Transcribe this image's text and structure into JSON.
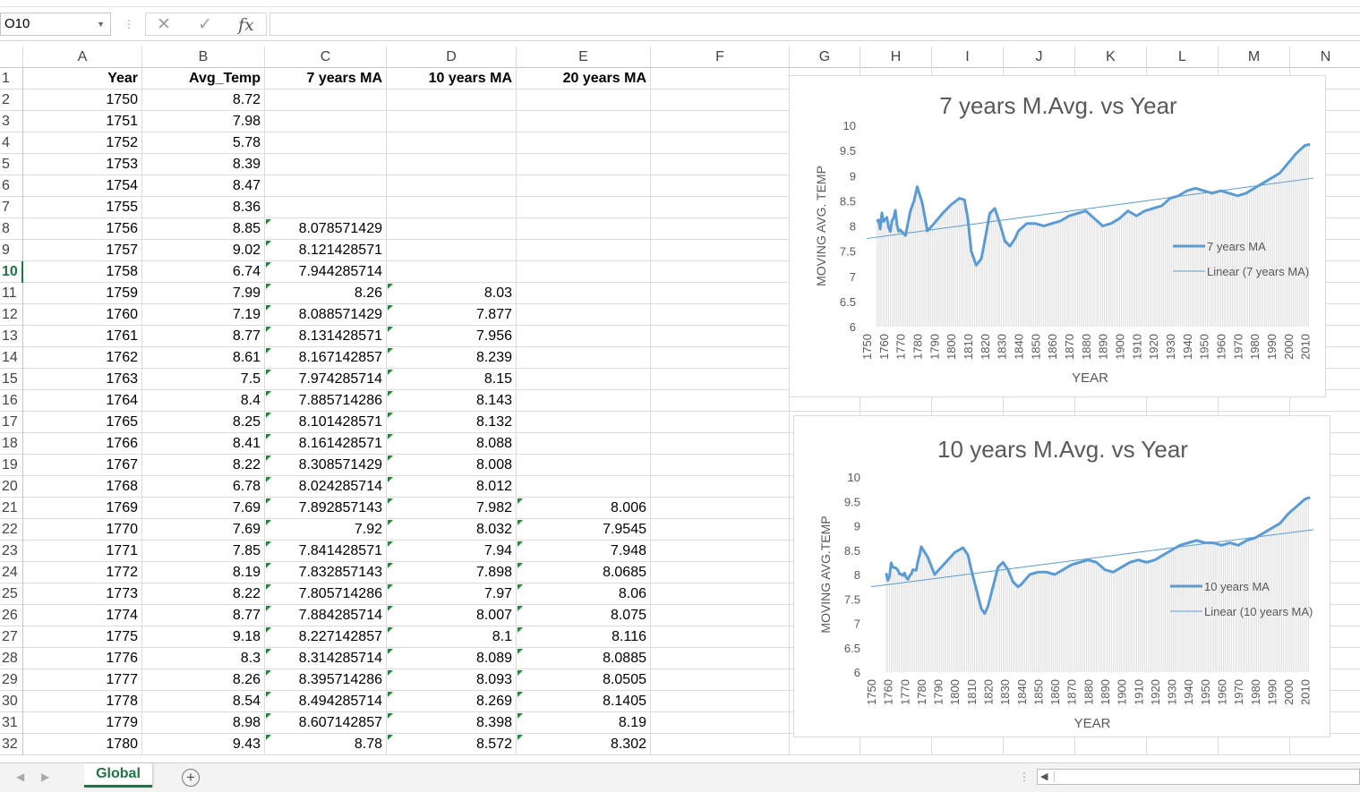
{
  "formula_bar": {
    "name_box": "O10",
    "fx_label": "fx",
    "formula": ""
  },
  "columns": [
    "A",
    "B",
    "C",
    "D",
    "E",
    "F",
    "G",
    "H",
    "I",
    "J",
    "K",
    "L",
    "M",
    "N"
  ],
  "headers": [
    "Year",
    "Avg_Temp",
    "7 years MA",
    "10 years MA",
    "20 years MA"
  ],
  "selected_row": 10,
  "rows": [
    {
      "r": 2,
      "year": "1750",
      "avg": "8.72",
      "ma7": "",
      "ma10": "",
      "ma20": ""
    },
    {
      "r": 3,
      "year": "1751",
      "avg": "7.98",
      "ma7": "",
      "ma10": "",
      "ma20": ""
    },
    {
      "r": 4,
      "year": "1752",
      "avg": "5.78",
      "ma7": "",
      "ma10": "",
      "ma20": ""
    },
    {
      "r": 5,
      "year": "1753",
      "avg": "8.39",
      "ma7": "",
      "ma10": "",
      "ma20": ""
    },
    {
      "r": 6,
      "year": "1754",
      "avg": "8.47",
      "ma7": "",
      "ma10": "",
      "ma20": ""
    },
    {
      "r": 7,
      "year": "1755",
      "avg": "8.36",
      "ma7": "",
      "ma10": "",
      "ma20": ""
    },
    {
      "r": 8,
      "year": "1756",
      "avg": "8.85",
      "ma7": "8.078571429",
      "ma10": "",
      "ma20": ""
    },
    {
      "r": 9,
      "year": "1757",
      "avg": "9.02",
      "ma7": "8.121428571",
      "ma10": "",
      "ma20": ""
    },
    {
      "r": 10,
      "year": "1758",
      "avg": "6.74",
      "ma7": "7.944285714",
      "ma10": "",
      "ma20": ""
    },
    {
      "r": 11,
      "year": "1759",
      "avg": "7.99",
      "ma7": "8.26",
      "ma10": "8.03",
      "ma20": ""
    },
    {
      "r": 12,
      "year": "1760",
      "avg": "7.19",
      "ma7": "8.088571429",
      "ma10": "7.877",
      "ma20": ""
    },
    {
      "r": 13,
      "year": "1761",
      "avg": "8.77",
      "ma7": "8.131428571",
      "ma10": "7.956",
      "ma20": ""
    },
    {
      "r": 14,
      "year": "1762",
      "avg": "8.61",
      "ma7": "8.167142857",
      "ma10": "8.239",
      "ma20": ""
    },
    {
      "r": 15,
      "year": "1763",
      "avg": "7.5",
      "ma7": "7.974285714",
      "ma10": "8.15",
      "ma20": ""
    },
    {
      "r": 16,
      "year": "1764",
      "avg": "8.4",
      "ma7": "7.885714286",
      "ma10": "8.143",
      "ma20": ""
    },
    {
      "r": 17,
      "year": "1765",
      "avg": "8.25",
      "ma7": "8.101428571",
      "ma10": "8.132",
      "ma20": ""
    },
    {
      "r": 18,
      "year": "1766",
      "avg": "8.41",
      "ma7": "8.161428571",
      "ma10": "8.088",
      "ma20": ""
    },
    {
      "r": 19,
      "year": "1767",
      "avg": "8.22",
      "ma7": "8.308571429",
      "ma10": "8.008",
      "ma20": ""
    },
    {
      "r": 20,
      "year": "1768",
      "avg": "6.78",
      "ma7": "8.024285714",
      "ma10": "8.012",
      "ma20": ""
    },
    {
      "r": 21,
      "year": "1769",
      "avg": "7.69",
      "ma7": "7.892857143",
      "ma10": "7.982",
      "ma20": "8.006"
    },
    {
      "r": 22,
      "year": "1770",
      "avg": "7.69",
      "ma7": "7.92",
      "ma10": "8.032",
      "ma20": "7.9545"
    },
    {
      "r": 23,
      "year": "1771",
      "avg": "7.85",
      "ma7": "7.841428571",
      "ma10": "7.94",
      "ma20": "7.948"
    },
    {
      "r": 24,
      "year": "1772",
      "avg": "8.19",
      "ma7": "7.832857143",
      "ma10": "7.898",
      "ma20": "8.0685"
    },
    {
      "r": 25,
      "year": "1773",
      "avg": "8.22",
      "ma7": "7.805714286",
      "ma10": "7.97",
      "ma20": "8.06"
    },
    {
      "r": 26,
      "year": "1774",
      "avg": "8.77",
      "ma7": "7.884285714",
      "ma10": "8.007",
      "ma20": "8.075"
    },
    {
      "r": 27,
      "year": "1775",
      "avg": "9.18",
      "ma7": "8.227142857",
      "ma10": "8.1",
      "ma20": "8.116"
    },
    {
      "r": 28,
      "year": "1776",
      "avg": "8.3",
      "ma7": "8.314285714",
      "ma10": "8.089",
      "ma20": "8.0885"
    },
    {
      "r": 29,
      "year": "1777",
      "avg": "8.26",
      "ma7": "8.395714286",
      "ma10": "8.093",
      "ma20": "8.0505"
    },
    {
      "r": 30,
      "year": "1778",
      "avg": "8.54",
      "ma7": "8.494285714",
      "ma10": "8.269",
      "ma20": "8.1405"
    },
    {
      "r": 31,
      "year": "1779",
      "avg": "8.98",
      "ma7": "8.607142857",
      "ma10": "8.398",
      "ma20": "8.19"
    },
    {
      "r": 32,
      "year": "1780",
      "avg": "9.43",
      "ma7": "8.78",
      "ma10": "8.572",
      "ma20": "8.302"
    }
  ],
  "sheet_tabs": [
    "Global"
  ],
  "chart_data": [
    {
      "type": "line",
      "title": "7 years M.Avg. vs Year",
      "xlabel": "YEAR",
      "ylabel": "MOVING AVG. TEMP",
      "ylim": [
        6,
        10
      ],
      "xlim": [
        1750,
        2015
      ],
      "yticks": [
        "6",
        "6.5",
        "7",
        "7.5",
        "8",
        "8.5",
        "9",
        "9.5",
        "10"
      ],
      "xticks": [
        "1750",
        "1760",
        "1770",
        "1780",
        "1790",
        "1800",
        "1810",
        "1820",
        "1830",
        "1840",
        "1850",
        "1860",
        "1870",
        "1880",
        "1890",
        "1900",
        "1910",
        "1920",
        "1930",
        "1940",
        "1950",
        "1960",
        "1970",
        "1980",
        "1990",
        "2000",
        "2010"
      ],
      "legend_position": "right",
      "series": [
        {
          "name": "7 years MA",
          "color": "#5b9bd5",
          "x": [
            1756,
            1757,
            1758,
            1759,
            1760,
            1761,
            1762,
            1763,
            1764,
            1765,
            1766,
            1767,
            1768,
            1769,
            1770,
            1773,
            1776,
            1778,
            1780,
            1783,
            1786,
            1790,
            1795,
            1800,
            1805,
            1808,
            1810,
            1812,
            1815,
            1818,
            1820,
            1823,
            1826,
            1829,
            1832,
            1835,
            1838,
            1840,
            1845,
            1850,
            1855,
            1860,
            1865,
            1870,
            1875,
            1880,
            1885,
            1890,
            1895,
            1900,
            1905,
            1910,
            1915,
            1920,
            1925,
            1930,
            1935,
            1940,
            1945,
            1950,
            1955,
            1960,
            1965,
            1970,
            1975,
            1980,
            1985,
            1990,
            1995,
            2000,
            2005,
            2010,
            2013
          ],
          "y": [
            8.08,
            8.12,
            7.94,
            8.26,
            8.09,
            8.13,
            8.17,
            7.97,
            7.89,
            8.1,
            8.16,
            8.31,
            8.02,
            7.89,
            7.92,
            7.81,
            8.31,
            8.49,
            8.78,
            8.45,
            7.9,
            8.05,
            8.25,
            8.42,
            8.55,
            8.52,
            8.15,
            7.5,
            7.22,
            7.35,
            7.7,
            8.25,
            8.35,
            8.05,
            7.7,
            7.6,
            7.75,
            7.9,
            8.05,
            8.05,
            8.0,
            8.05,
            8.1,
            8.2,
            8.25,
            8.3,
            8.15,
            8.0,
            8.05,
            8.15,
            8.3,
            8.2,
            8.3,
            8.35,
            8.4,
            8.55,
            8.6,
            8.7,
            8.75,
            8.7,
            8.65,
            8.7,
            8.65,
            8.6,
            8.65,
            8.75,
            8.85,
            8.95,
            9.05,
            9.25,
            9.45,
            9.6,
            9.62
          ]
        },
        {
          "name": "Linear (7 years MA)",
          "color": "#5b9bd5",
          "x": [
            1750,
            2015
          ],
          "y": [
            7.75,
            8.95
          ]
        }
      ]
    },
    {
      "type": "line",
      "title": "10 years M.Avg. vs Year",
      "xlabel": "YEAR",
      "ylabel": "MOVING AVG.TEMP",
      "ylim": [
        6,
        10
      ],
      "xlim": [
        1750,
        2015
      ],
      "yticks": [
        "6",
        "6.5",
        "7",
        "7.5",
        "8",
        "8.5",
        "9",
        "9.5",
        "10"
      ],
      "xticks": [
        "1750",
        "1760",
        "1770",
        "1780",
        "1790",
        "1800",
        "1810",
        "1820",
        "1830",
        "1840",
        "1850",
        "1860",
        "1870",
        "1880",
        "1890",
        "1900",
        "1910",
        "1920",
        "1930",
        "1940",
        "1950",
        "1960",
        "1970",
        "1980",
        "1990",
        "2000",
        "2010"
      ],
      "legend_position": "right",
      "series": [
        {
          "name": "10 years MA",
          "color": "#5b9bd5",
          "x": [
            1759,
            1760,
            1761,
            1762,
            1763,
            1764,
            1765,
            1766,
            1767,
            1768,
            1769,
            1770,
            1771,
            1772,
            1773,
            1774,
            1775,
            1776,
            1777,
            1778,
            1779,
            1780,
            1784,
            1788,
            1792,
            1796,
            1800,
            1805,
            1808,
            1810,
            1813,
            1816,
            1818,
            1820,
            1823,
            1826,
            1829,
            1832,
            1835,
            1838,
            1840,
            1845,
            1850,
            1855,
            1860,
            1865,
            1870,
            1875,
            1880,
            1885,
            1890,
            1895,
            1900,
            1905,
            1910,
            1915,
            1920,
            1925,
            1930,
            1935,
            1940,
            1945,
            1950,
            1955,
            1960,
            1965,
            1970,
            1975,
            1980,
            1985,
            1990,
            1995,
            2000,
            2005,
            2010,
            2013
          ],
          "y": [
            8.03,
            7.88,
            7.96,
            8.24,
            8.15,
            8.14,
            8.13,
            8.09,
            8.01,
            8.01,
            7.98,
            8.03,
            7.94,
            7.9,
            7.97,
            8.01,
            8.1,
            8.09,
            8.09,
            8.27,
            8.4,
            8.57,
            8.35,
            8.0,
            8.15,
            8.3,
            8.45,
            8.55,
            8.4,
            8.1,
            7.7,
            7.3,
            7.2,
            7.35,
            7.75,
            8.15,
            8.25,
            8.1,
            7.85,
            7.75,
            7.8,
            8.0,
            8.05,
            8.05,
            8.0,
            8.1,
            8.2,
            8.25,
            8.3,
            8.25,
            8.1,
            8.05,
            8.15,
            8.25,
            8.3,
            8.25,
            8.3,
            8.4,
            8.5,
            8.6,
            8.65,
            8.7,
            8.65,
            8.65,
            8.6,
            8.65,
            8.6,
            8.7,
            8.75,
            8.85,
            8.95,
            9.05,
            9.25,
            9.4,
            9.55,
            9.58
          ]
        },
        {
          "name": "Linear (10 years MA)",
          "color": "#5b9bd5",
          "x": [
            1750,
            2015
          ],
          "y": [
            7.75,
            8.92
          ]
        }
      ]
    }
  ]
}
